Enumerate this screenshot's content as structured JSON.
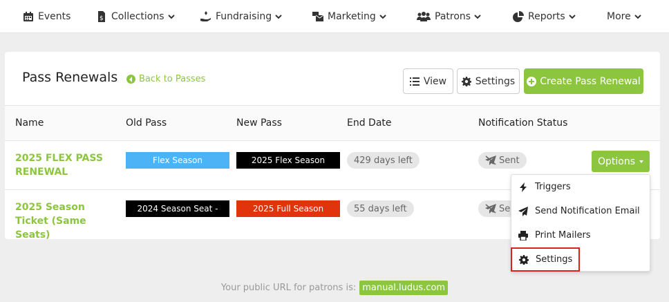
{
  "nav": {
    "items": [
      {
        "label": "Events",
        "icon": "calendar-icon"
      },
      {
        "label": "Collections",
        "icon": "document-dollar-icon"
      },
      {
        "label": "Fundraising",
        "icon": "hand-donate-icon"
      },
      {
        "label": "Marketing",
        "icon": "mail-bulk-icon"
      },
      {
        "label": "Patrons",
        "icon": "users-icon"
      },
      {
        "label": "Reports",
        "icon": "pie-chart-icon"
      },
      {
        "label": "More",
        "icon": ""
      }
    ]
  },
  "page": {
    "title": "Pass Renewals",
    "back_label": "Back to Passes",
    "view_label": "View",
    "settings_label": "Settings",
    "create_label": "Create Pass Renewal"
  },
  "table": {
    "headers": [
      "Name",
      "Old Pass",
      "New Pass",
      "End Date",
      "Notification Status"
    ],
    "rows": [
      {
        "name": "2025 FLEX PASS RENEWAL",
        "old_pass": "Flex Season",
        "old_pass_color": "#4db3f7",
        "new_pass": "2025 Flex Season",
        "new_pass_color": "#000000",
        "end_date": "429 days left",
        "status": "Sent",
        "options_label": "Options"
      },
      {
        "name": "2025 Season Ticket (Same Seats)",
        "old_pass": "2024 Season Seat -",
        "old_pass_color": "#000000",
        "new_pass": "2025 Full Season",
        "new_pass_color": "#e2340c",
        "end_date": "55 days left",
        "status": "Se"
      }
    ]
  },
  "dropdown": {
    "items": [
      {
        "label": "Triggers",
        "icon": "bolt-icon"
      },
      {
        "label": "Send Notification Email",
        "icon": "paper-plane-icon"
      },
      {
        "label": "Print Mailers",
        "icon": "printer-icon"
      },
      {
        "label": "Settings",
        "icon": "gear-icon"
      }
    ]
  },
  "footer": {
    "text": "Your public URL for patrons is:",
    "url": "manual.ludus.com"
  },
  "colors": {
    "accent": "#8cc63f",
    "highlight": "#d9221c"
  }
}
